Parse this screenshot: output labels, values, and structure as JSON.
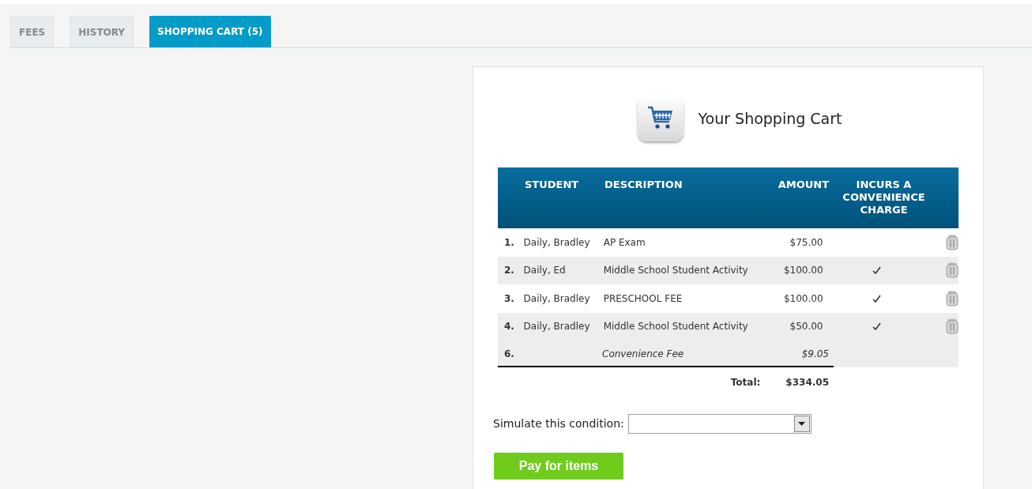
{
  "tabs": [
    {
      "label": "FEES",
      "selected": false
    },
    {
      "label": "HISTORY",
      "selected": false
    },
    {
      "label": "SHOPPING CART (5)",
      "selected": true
    }
  ],
  "cart": {
    "title": "Your Shopping Cart",
    "table": {
      "columns": [
        "STUDENT",
        "DESCRIPTION",
        "AMOUNT",
        "INCURS A CONVENIENCE CHARGE"
      ],
      "rows": [
        {
          "kind": "item",
          "number": "1.",
          "student": "Daily, Bradley",
          "description": "AP Exam",
          "amount": "$75.00",
          "convenience": false
        },
        {
          "kind": "item",
          "number": "2.",
          "student": "Daily, Ed",
          "description": "Middle School Student Activity",
          "amount": "$100.00",
          "convenience": true
        },
        {
          "kind": "item",
          "number": "3.",
          "student": "Daily, Bradley",
          "description": "PRESCHOOL FEE",
          "amount": "$100.00",
          "convenience": true
        },
        {
          "kind": "item",
          "number": "4.",
          "student": "Daily, Bradley",
          "description": "Middle School Student Activity",
          "amount": "$50.00",
          "convenience": true
        },
        {
          "kind": "fee",
          "number": "6.",
          "description": "Convenience Fee",
          "amount": "$9.05"
        }
      ],
      "total_label": "Total:",
      "total": "$334.05"
    },
    "simulate": {
      "label": "Simulate this condition:"
    },
    "pay_button": "Pay for items"
  }
}
